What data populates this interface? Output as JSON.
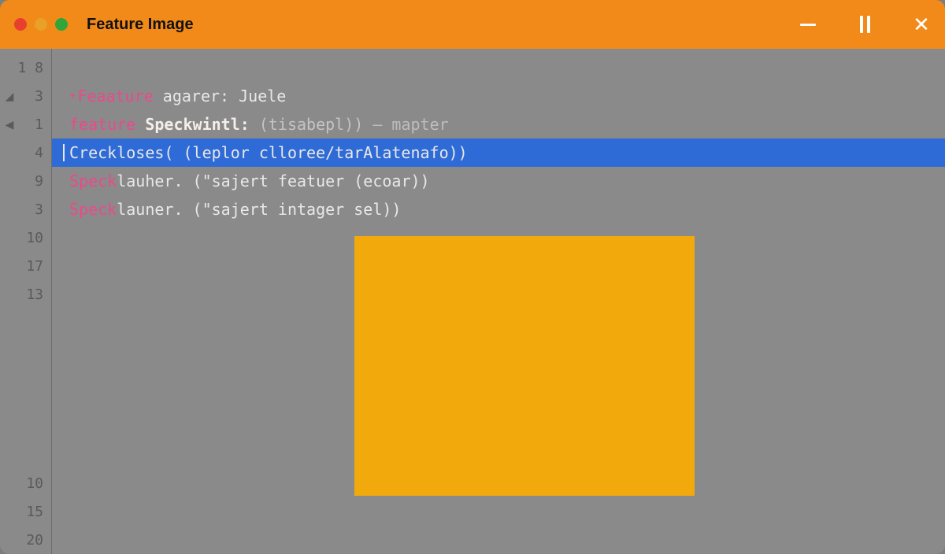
{
  "titlebar": {
    "title": "Feature Image"
  },
  "gutter": {
    "lines_top": [
      "1 8",
      "3",
      "1",
      "4",
      "9",
      "3",
      "10",
      "17",
      "13"
    ],
    "lines_bottom": [
      "10",
      "15",
      "20"
    ]
  },
  "code": {
    "l1": {
      "k": "Feaature",
      "rest": " agarer: Juele"
    },
    "l2": {
      "k": "feature",
      "type": " Speckwintl:",
      "args": " (tisabepl)) ",
      "dash": "— mapter"
    },
    "l3": {
      "text": "Creckloses( (leplor clloree/tarAlatenafo))"
    },
    "l4": {
      "k": "Speck",
      "rest": "lauher. (\"sajert featuer (ecoar))"
    },
    "l5": {
      "k": "Speck",
      "rest": "launer. (\"sajert intager sel))"
    }
  }
}
